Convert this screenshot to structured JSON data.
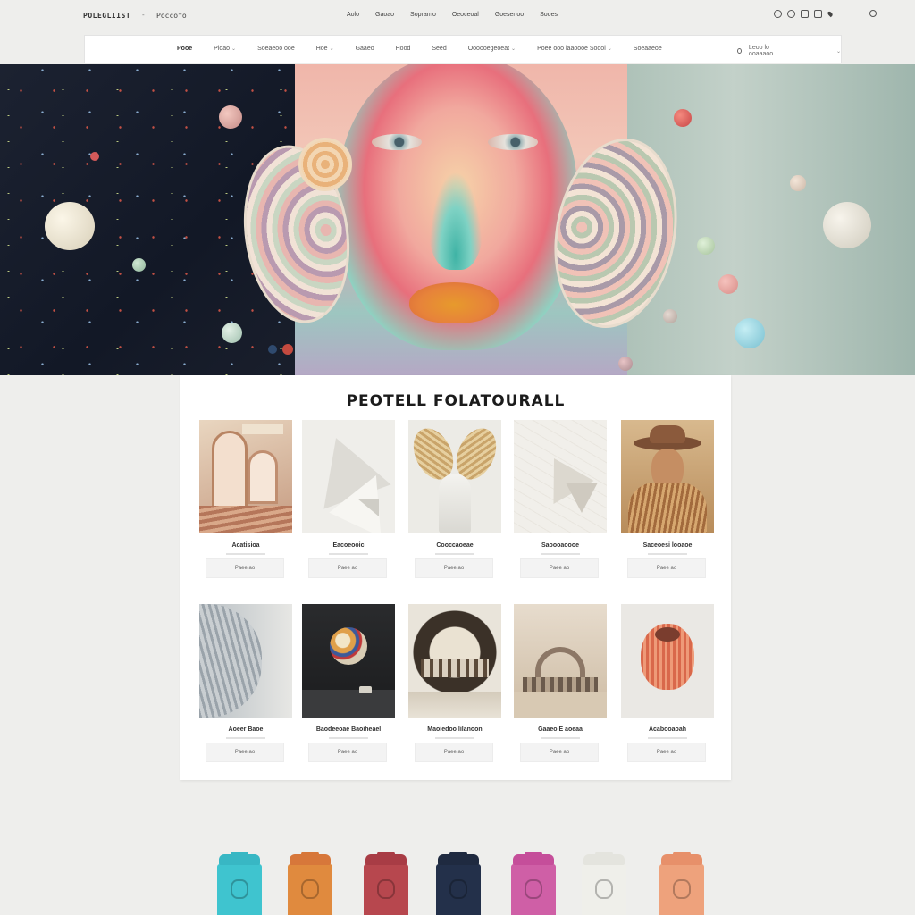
{
  "header": {
    "brand": "POLEGLIIST",
    "separator": "-",
    "subtitle": "Poccofo",
    "links": [
      "Aolo",
      "Gaoao",
      "Soprarno",
      "Oeoceoal",
      "Goesenoo",
      "Sooes"
    ],
    "icons": [
      "chat-icon",
      "settings-icon",
      "grid-icon",
      "mail-icon",
      "pin-icon"
    ],
    "user_icon": "user-icon"
  },
  "nav": {
    "items": [
      {
        "label": "Pooe",
        "dropdown": false
      },
      {
        "label": "Ploao",
        "dropdown": true
      },
      {
        "label": "Soeaeoo ooe",
        "dropdown": false
      },
      {
        "label": "Hoe",
        "dropdown": true
      },
      {
        "label": "Gaaeo",
        "dropdown": false
      },
      {
        "label": "Hood",
        "dropdown": false
      },
      {
        "label": "Seed",
        "dropdown": false
      },
      {
        "label": "Oooooegeoeat",
        "dropdown": true
      },
      {
        "label": "Poee ooo laaoooe Soooi",
        "dropdown": true
      },
      {
        "label": "Soeaaeoe",
        "dropdown": false
      }
    ],
    "search_placeholder": "Leoo lo ooaaaoo"
  },
  "gallery": {
    "title": "PEOTELL FOLATOURALL",
    "items": [
      {
        "name": "Acatisioa",
        "button": "Paee ao",
        "art": "archway"
      },
      {
        "name": "Eacoeooic",
        "button": "Paee ao",
        "art": "paper-fold"
      },
      {
        "name": "Cooccaoeae",
        "button": "Paee ao",
        "art": "wheat-figure"
      },
      {
        "name": "Saoooaoooe",
        "button": "Paee ao",
        "art": "paper-map"
      },
      {
        "name": "Saceoesi looaoe",
        "button": "Paee ao",
        "art": "cowboy-portrait"
      },
      {
        "name": "Aoeer Baoe",
        "button": "Paee ao",
        "art": "grey-hair"
      },
      {
        "name": "Baodeeoae Baoiheael",
        "button": "Paee ao",
        "art": "dark-sphere"
      },
      {
        "name": "Maoiedoo lilanoon",
        "button": "Paee ao",
        "art": "round-scene"
      },
      {
        "name": "Gaaeo E aoeaa",
        "button": "Paee ao",
        "art": "desert-arch"
      },
      {
        "name": "Acabooaoah",
        "button": "Paee ao",
        "art": "orange-fruit"
      }
    ]
  },
  "cups": [
    {
      "color": "#3fc4cf",
      "lid": "#38b7c4"
    },
    {
      "color": "#e08a3e",
      "lid": "#d7773a"
    },
    {
      "color": "#b7474e",
      "lid": "#a83c45"
    },
    {
      "color": "#23304a",
      "lid": "#1f2a40"
    },
    {
      "color": "#cf5fa6",
      "lid": "#c54e9a"
    },
    {
      "color": "#efefea",
      "lid": "#e4e4de"
    },
    {
      "color": "#eea27c",
      "lid": "#e7906a"
    }
  ]
}
